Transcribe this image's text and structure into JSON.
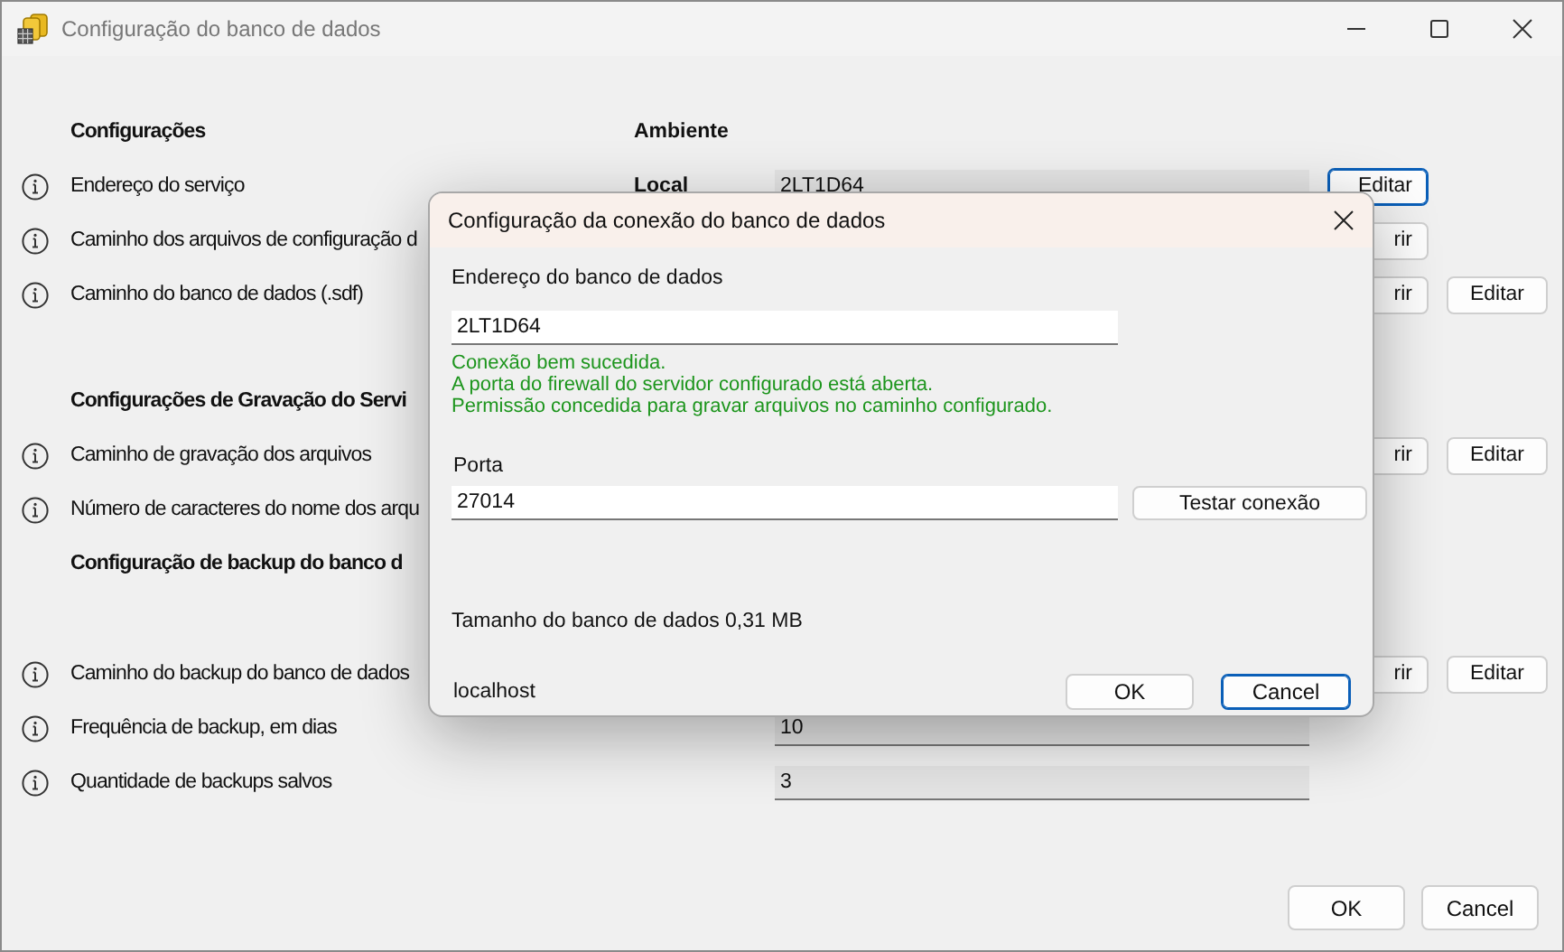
{
  "window": {
    "title": "Configuração do banco de dados"
  },
  "sections": [
    {
      "heading": "Configurações",
      "column_heading": "Ambiente",
      "rows": [
        {
          "label": "Endereço do serviço",
          "environment": "Local",
          "value": "2LT1D64",
          "buttons": [
            {
              "label": "Editar",
              "focused": true
            }
          ]
        },
        {
          "label": "Caminho dos arquivos de configuração d",
          "buttons": [
            {
              "label": "rir",
              "focused": false
            }
          ]
        },
        {
          "label": "Caminho do banco de dados (.sdf)",
          "buttons": [
            {
              "label": "rir",
              "focused": false
            },
            {
              "label": "Editar",
              "focused": false
            }
          ]
        }
      ]
    },
    {
      "heading": "Configurações de Gravação do Servi",
      "rows": [
        {
          "label": "Caminho de gravação dos arquivos",
          "buttons": [
            {
              "label": "rir",
              "focused": false
            },
            {
              "label": "Editar",
              "focused": false
            }
          ]
        },
        {
          "label": "Número de caracteres do nome dos arqu",
          "buttons": []
        }
      ]
    },
    {
      "heading": "Configuração de backup do banco d",
      "rows": [
        {
          "label": "Caminho do backup do banco de dados",
          "buttons": [
            {
              "label": "rir",
              "focused": false
            },
            {
              "label": "Editar",
              "focused": false
            }
          ]
        },
        {
          "label": "Frequência de backup, em dias",
          "value": "10",
          "buttons": []
        },
        {
          "label": "Quantidade de backups salvos",
          "value": "3",
          "buttons": []
        }
      ]
    }
  ],
  "buttons": [
    {
      "label": "OK",
      "focused": false
    },
    {
      "label": "Cancel",
      "focused": false
    }
  ],
  "dialog": {
    "title": "Configuração da conexão do banco de dados",
    "address_label": "Endereço do banco de dados",
    "address": "2LT1D64",
    "messages": [
      "Conexão bem sucedida.",
      "A porta do firewall do servidor configurado está aberta.",
      "Permissão concedida para gravar arquivos no caminho configurado."
    ],
    "port_label": "Porta",
    "port": "27014",
    "test_button": "Testar conexão",
    "size": "Tamanho do banco de dados 0,31 MB",
    "host": "localhost",
    "buttons": [
      {
        "label": "OK",
        "focused": false
      },
      {
        "label": "Cancel",
        "focused": true
      }
    ]
  }
}
